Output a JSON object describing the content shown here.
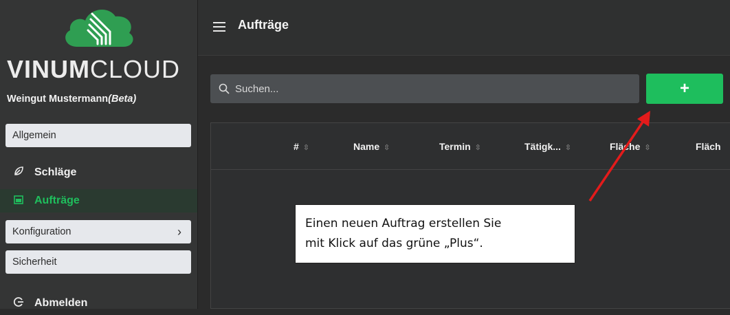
{
  "app": {
    "brand_bold": "VINUM",
    "brand_light": "CLOUD",
    "company": "Weingut Mustermann",
    "company_tag": "(Beta)",
    "brand_color": "#2f9e52",
    "accent_color": "#1ebe5d"
  },
  "sidebar": {
    "items": [
      {
        "label": "Allgemein",
        "type": "box"
      },
      {
        "label": "Schläge",
        "type": "link",
        "icon": "leaf-icon"
      },
      {
        "label": "Aufträge",
        "type": "link",
        "icon": "calendar-icon",
        "active": true
      },
      {
        "label": "Konfiguration",
        "type": "box",
        "chevron": "›"
      },
      {
        "label": "Sicherheit",
        "type": "box"
      },
      {
        "label": "Abmelden",
        "type": "link",
        "icon": "logout-icon"
      }
    ]
  },
  "header": {
    "title": "Aufträge",
    "menu_icon": "hamburger-icon"
  },
  "search": {
    "placeholder": "Suchen...",
    "icon": "search-icon"
  },
  "add_button": {
    "label": "+"
  },
  "table": {
    "columns": [
      "#",
      "Name",
      "Termin",
      "Tätigk...",
      "Fläche",
      "Fläch"
    ],
    "sort_glyph": "⇳"
  },
  "callout": {
    "line1": "Einen neuen Auftrag erstellen Sie",
    "line2": "mit Klick auf das grüne „Plus“.",
    "arrow_color": "#e31b1b"
  }
}
